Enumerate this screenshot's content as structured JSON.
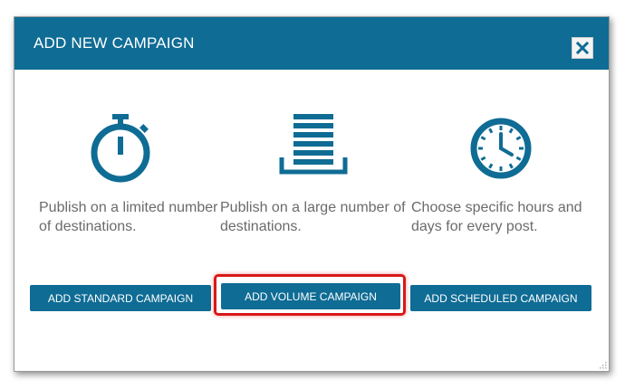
{
  "dialog": {
    "title": "ADD NEW CAMPAIGN",
    "close_icon": "close-icon"
  },
  "options": [
    {
      "icon": "stopwatch-icon",
      "description": "Publish on a limited number of destinations.",
      "button_label": "ADD STANDARD CAMPAIGN"
    },
    {
      "icon": "stack-icon",
      "description": "Publish on a large number of destinations.",
      "button_label": "ADD VOLUME CAMPAIGN",
      "highlighted": true
    },
    {
      "icon": "clock-icon",
      "description": "Choose specific hours and days for every post.",
      "button_label": "ADD SCHEDULED CAMPAIGN"
    }
  ],
  "colors": {
    "primary": "#0f6c94",
    "highlight": "#d81818",
    "text": "#6b6b6b"
  }
}
